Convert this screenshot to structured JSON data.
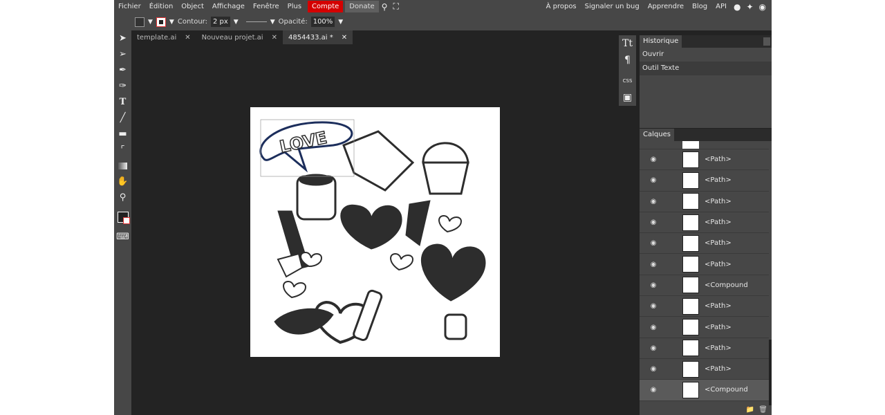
{
  "menu": {
    "items": [
      "Fichier",
      "Édition",
      "Object",
      "Affichage",
      "Fenêtre",
      "Plus"
    ],
    "compte": "Compte",
    "donate": "Donate",
    "right": [
      "À propos",
      "Signaler un bug",
      "Apprendre",
      "Blog",
      "API"
    ]
  },
  "options": {
    "contour_label": "Contour:",
    "contour_value": "2 px",
    "opacity_label": "Opacité:",
    "opacity_value": "100%"
  },
  "tabs": [
    {
      "label": "template.ai",
      "active": false
    },
    {
      "label": "Nouveau projet.ai",
      "active": false
    },
    {
      "label": "4854433.ai *",
      "active": true
    }
  ],
  "artwork": {
    "love_text": "LOVE"
  },
  "icon_column": {
    "css": "CSS"
  },
  "history": {
    "title": "Historique",
    "items": [
      "Ouvrir",
      "Outil Texte"
    ]
  },
  "layers": {
    "title": "Calques",
    "items": [
      "<Path>",
      "<Path>",
      "<Path>",
      "<Path>",
      "<Path>",
      "<Path>",
      "<Compound Path>",
      "<Path>",
      "<Path>",
      "<Path>",
      "<Path>",
      "<Compound Path>"
    ]
  },
  "colors": {
    "compte": "#d40000",
    "selection": "#1c2e5c"
  }
}
